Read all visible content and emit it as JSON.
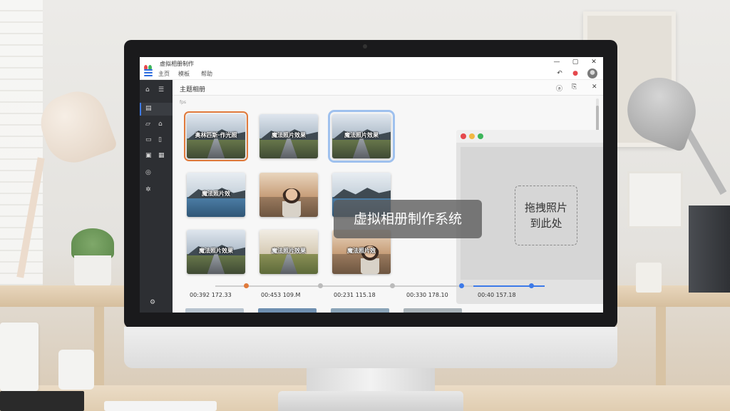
{
  "window": {
    "title": "虚拟相册制作",
    "minimize": "—",
    "maximize": "▢",
    "close": "✕"
  },
  "menu": {
    "items": [
      "主页",
      "模板",
      "帮助"
    ]
  },
  "toolbar_icons": [
    "undo-icon",
    "record-icon",
    "user-avatar"
  ],
  "sidebar": {
    "items": [
      {
        "icon": "home-icon",
        "glyph": "⌂"
      },
      {
        "icon": "album-icon",
        "glyph": "▤"
      },
      {
        "icon": "photo-icon",
        "glyph": "⌂"
      },
      {
        "icon": "music-icon",
        "glyph": "♪"
      },
      {
        "icon": "text-icon",
        "glyph": "⌗"
      },
      {
        "icon": "effects-icon",
        "glyph": "⚙"
      },
      {
        "icon": "settings-icon",
        "glyph": "⚙"
      }
    ]
  },
  "content": {
    "title": "主题相册",
    "sub_tab": "fps"
  },
  "thumbnails": [
    {
      "caption": "奥林匹斯·作光照",
      "kind": "road"
    },
    {
      "caption": "魔法照片效果",
      "kind": "road"
    },
    {
      "caption": "魔法照片效果",
      "kind": "road"
    },
    {
      "caption": "魔法照片效",
      "kind": "lake"
    },
    {
      "caption": "",
      "kind": "person"
    },
    {
      "caption": "",
      "kind": "lake"
    },
    {
      "caption": "魔法照片效果",
      "kind": "road"
    },
    {
      "caption": "魔法照片效果",
      "kind": "field"
    },
    {
      "caption": "魔法照片效",
      "kind": "person"
    }
  ],
  "overlay": {
    "text": "虚拟相册制作系统"
  },
  "preview": {
    "dropzone_line1": "拖拽照片",
    "dropzone_line2": "到此处"
  },
  "timeline": {
    "labels": [
      "00:392 172.33",
      "00:453 109.M",
      "00:231 115.18",
      "00:330 178.10",
      "00:40 157.18"
    ]
  },
  "colors": {
    "accent": "#3d7ae8",
    "selection_orange": "#e07a3c",
    "selection_blue": "#9fc1ee",
    "sidebar_bg": "#2d2f33"
  }
}
